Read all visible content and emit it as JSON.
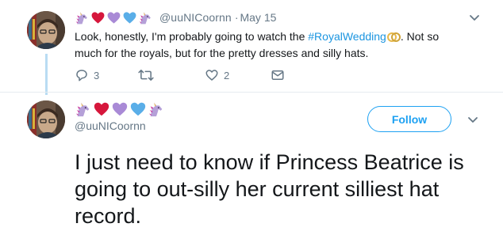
{
  "colors": {
    "link": "#1b95e0",
    "follow": "#1da1f2",
    "muted": "#657786",
    "thread_line": "#b9dcf3"
  },
  "tweet1": {
    "emojis": [
      "unicorn-icon",
      "red-heart-icon",
      "purple-heart-icon",
      "blue-heart-icon",
      "unicorn-icon"
    ],
    "handle": "@uuNICoornn",
    "separator": "·",
    "time": "May 15",
    "text_before": "Look, honestly, I'm probably going to watch the ",
    "hashtag": "#RoyalWedding",
    "hashtag_emoji": "ring-icon",
    "text_after": ". Not so much for the royals, but for the pretty dresses and silly hats.",
    "actions": {
      "reply_count": "3",
      "retweet_count": "",
      "like_count": "2"
    }
  },
  "tweet2": {
    "emojis": [
      "unicorn-icon",
      "red-heart-icon",
      "purple-heart-icon",
      "blue-heart-icon",
      "unicorn-icon"
    ],
    "handle": "@uuNICoornn",
    "follow_label": "Follow",
    "text": "I just need to know if Princess Beatrice is going to out-silly her current silliest hat record."
  }
}
